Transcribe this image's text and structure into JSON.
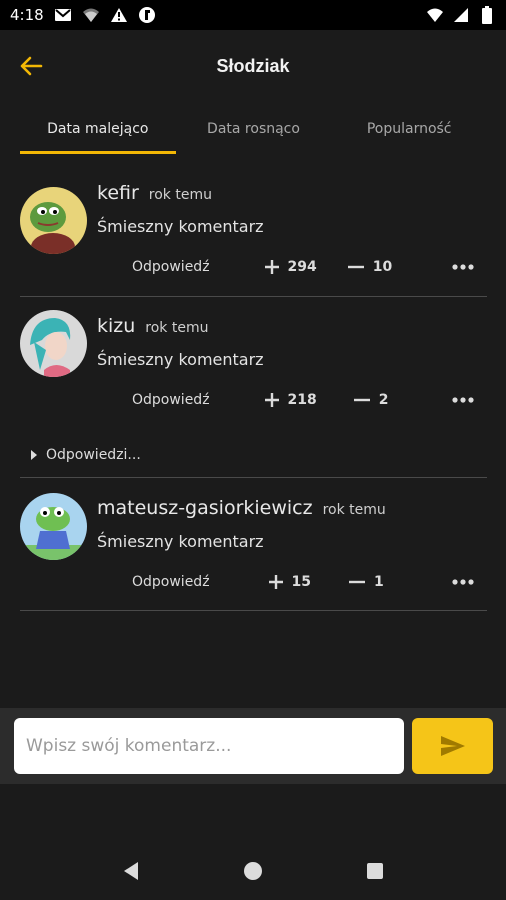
{
  "status_bar": {
    "time": "4:18"
  },
  "header": {
    "title": "Słodziak"
  },
  "tabs": [
    {
      "label": "Data malejąco",
      "active": true
    },
    {
      "label": "Data rosnąco",
      "active": false
    },
    {
      "label": "Popularność",
      "active": false
    }
  ],
  "comments": [
    {
      "author": "kefir",
      "time": "rok temu",
      "text": "Śmieszny komentarz",
      "reply_label": "Odpowiedź",
      "upvotes": "294",
      "downvotes": "10"
    },
    {
      "author": "kizu",
      "time": "rok temu",
      "text": "Śmieszny komentarz",
      "reply_label": "Odpowiedź",
      "upvotes": "218",
      "downvotes": "2"
    },
    {
      "author": "mateusz-gasiorkiewicz",
      "time": "rok temu",
      "text": "Śmieszny komentarz",
      "reply_label": "Odpowiedź",
      "upvotes": "15",
      "downvotes": "1"
    }
  ],
  "replies_toggle": {
    "label": "Odpowiedzi..."
  },
  "composer": {
    "placeholder": "Wpisz swój komentarz..."
  },
  "colors": {
    "accent": "#f2b705",
    "background": "#1b1b1b"
  }
}
